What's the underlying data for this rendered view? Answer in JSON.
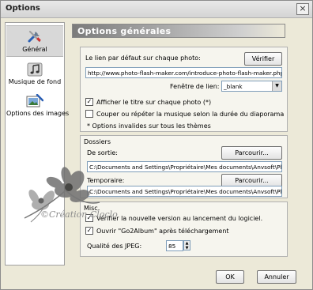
{
  "window": {
    "title": "Options",
    "close_glyph": "×"
  },
  "sidebar": {
    "items": [
      {
        "label": "Général",
        "icon": "tools-icon",
        "active": true
      },
      {
        "label": "Musique de fond",
        "icon": "music-note-icon",
        "active": false
      },
      {
        "label": "Options des images",
        "icon": "image-icon",
        "active": false
      }
    ]
  },
  "header": {
    "title": "Options générales"
  },
  "general": {
    "link_label": "Le lien par défaut sur chaque photo:",
    "link_value": "http://www.photo-flash-maker.com/introduce-photo-flash-maker.php",
    "verify_button": "Vérifier",
    "window_label": "Fenêtre de lien:",
    "window_value": "_blank",
    "show_title_label": "Afficher le titre sur chaque photo (*)",
    "show_title_checked": true,
    "cut_music_label": "Couper ou répéter la musique selon la durée du diaporama",
    "cut_music_checked": false,
    "note": "* Options invalides sur tous les thèmes"
  },
  "folders": {
    "section_title": "Dossiers",
    "output_label": "De sortie:",
    "output_value": "C:\\Documents and Settings\\Propriétaire\\Mes documents\\Anvsoft\\Photo",
    "temp_label": "Temporaire:",
    "temp_value": "C:\\Documents and Settings\\Propriétaire\\Mes documents\\Anvsoft\\Photo",
    "browse_label": "Parcourir..."
  },
  "misc": {
    "section_title": "Misc.",
    "check_version_label": "Vérifier la nouvelle version au lancement du logiciel.",
    "check_version_checked": true,
    "open_album_label": "Ouvrir \"Go2Album\" après téléchargement",
    "open_album_checked": true,
    "jpeg_label": "Qualité des JPEG:",
    "jpeg_value": "85"
  },
  "footer": {
    "ok_label": "OK",
    "cancel_label": "Annuler"
  },
  "watermark": {
    "text": "©Création Cloclo"
  },
  "colors": {
    "dialog_bg": "#ece9d8",
    "input_border": "#7f9db9",
    "header_gradient_start": "#7b7b7b"
  }
}
